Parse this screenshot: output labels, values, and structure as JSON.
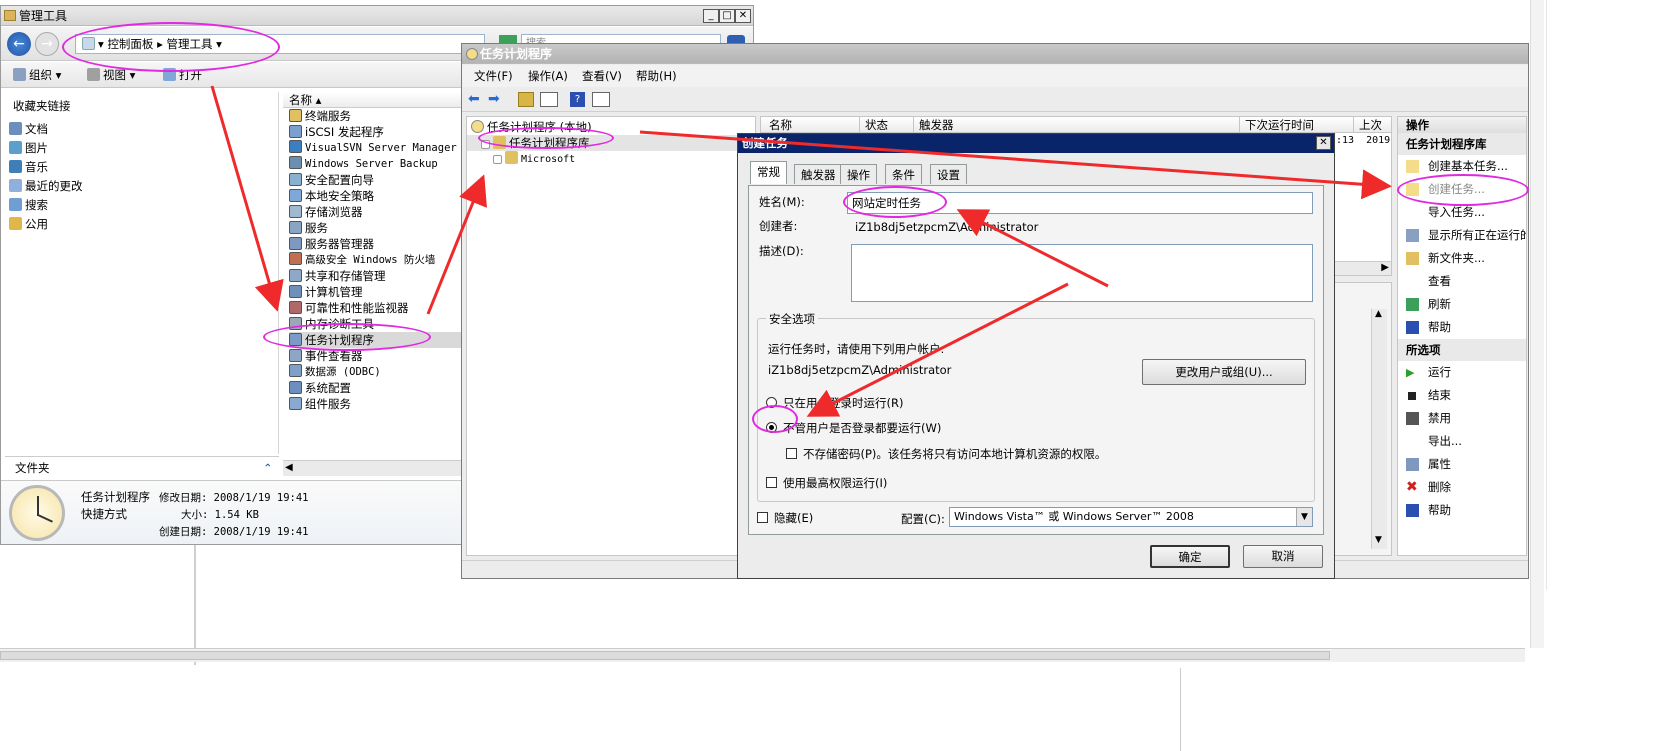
{
  "explorer": {
    "title": "管理工具",
    "address": [
      "控制面板",
      "管理工具"
    ],
    "search_placeholder": "搜索",
    "toolbar": {
      "organize": "组织",
      "view": "视图",
      "open": "打开"
    },
    "favorites_header": "收藏夹链接",
    "favorites": [
      "文档",
      "图片",
      "音乐",
      "最近的更改",
      "搜索",
      "公用"
    ],
    "folders_label": "文件夹",
    "column_name": "名称",
    "items": [
      "终端服务",
      "iSCSI 发起程序",
      "VisualSVN Server Manager",
      "Windows Server Backup",
      "安全配置向导",
      "本地安全策略",
      "存储浏览器",
      "服务",
      "服务器管理器",
      "高级安全 Windows 防火墙",
      "共享和存储管理",
      "计算机管理",
      "可靠性和性能监视器",
      "内存诊断工具",
      "任务计划程序",
      "事件查看器",
      "数据源 (ODBC)",
      "系统配置",
      "组件服务"
    ],
    "details": {
      "name": "任务计划程序",
      "type": "快捷方式",
      "modified_label": "修改日期:",
      "modified": "2008/1/19 19:41",
      "size_label": "大小:",
      "size": "1.54 KB",
      "created_label": "创建日期:",
      "created": "2008/1/19 19:41"
    }
  },
  "scheduler": {
    "title": "任务计划程序",
    "menu": [
      "文件(F)",
      "操作(A)",
      "查看(V)",
      "帮助(H)"
    ],
    "tree": {
      "root": "任务计划程序 (本地)",
      "library": "任务计划程序库",
      "child": "Microsoft"
    },
    "columns": [
      "名称",
      "状态",
      "触发器",
      "下次运行时间",
      "上次"
    ],
    "row_tail": [
      ":13",
      "2019"
    ],
    "actions_header": "操作",
    "actions_section1": "任务计划程序库",
    "actions1": [
      "创建基本任务...",
      "创建任务...",
      "导入任务...",
      "显示所有正在运行的",
      "新文件夹...",
      "查看",
      "刷新",
      "帮助"
    ],
    "actions_section2": "所选项",
    "actions2": [
      "运行",
      "结束",
      "禁用",
      "导出...",
      "属性",
      "删除",
      "帮助"
    ]
  },
  "dialog": {
    "title": "创建任务",
    "tabs": [
      "常规",
      "触发器",
      "操作",
      "条件",
      "设置"
    ],
    "name_label": "姓名(M):",
    "name_value": "网站定时任务",
    "author_label": "创建者:",
    "author_value": "iZ1b8dj5etzpcmZ\\Administrator",
    "desc_label": "描述(D):",
    "security_group": "安全选项",
    "run_as_text": "运行任务时，请使用下列用户帐户:",
    "run_as_user": "iZ1b8dj5etzpcmZ\\Administrator",
    "change_user_btn": "更改用户或组(U)...",
    "radio_logged_on": "只在用户登录时运行(R)",
    "radio_always": "不管用户是否登录都要运行(W)",
    "chk_no_password": "不存储密码(P)。该任务将只有访问本地计算机资源的权限。",
    "chk_highest": "使用最高权限运行(I)",
    "chk_hidden": "隐藏(E)",
    "config_label": "配置(C):",
    "config_value": "Windows Vista™ 或 Windows Server™ 2008",
    "ok": "确定",
    "cancel": "取消"
  },
  "colors": {
    "highlight": "#e029e0",
    "arrow": "#ee2a2a",
    "dialog_title": "#0a246a",
    "selection": "#d9d9d9"
  }
}
